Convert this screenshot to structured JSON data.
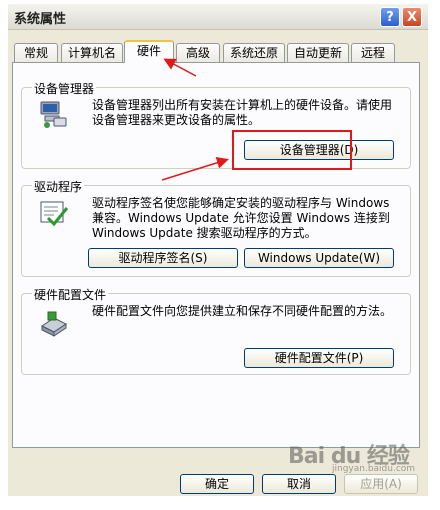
{
  "window": {
    "title": "系统属性",
    "help_label": "?",
    "close_label": "X"
  },
  "tabs": [
    {
      "label": "常规"
    },
    {
      "label": "计算机名"
    },
    {
      "label": "硬件",
      "active": true
    },
    {
      "label": "高级"
    },
    {
      "label": "系统还原"
    },
    {
      "label": "自动更新"
    },
    {
      "label": "远程"
    }
  ],
  "groups": {
    "device_manager": {
      "title": "设备管理器",
      "icon": "device-manager-icon",
      "description": "设备管理器列出所有安装在计算机上的硬件设备。请使用设备管理器来更改设备的属性。",
      "button_label": "设备管理器(D)"
    },
    "drivers": {
      "title": "驱动程序",
      "icon": "driver-signing-icon",
      "description": "驱动程序签名使您能够确定安装的驱动程序与 Windows 兼容。Windows Update 允许您设置 Windows 连接到 Windows Update 搜索驱动程序的方式。",
      "signing_button_label": "驱动程序签名(S)",
      "update_button_label": "Windows Update(W)"
    },
    "hardware_profiles": {
      "title": "硬件配置文件",
      "icon": "hardware-profile-icon",
      "description": "硬件配置文件向您提供建立和保存不同硬件配置的方法。",
      "button_label": "硬件配置文件(P)"
    }
  },
  "dialog_buttons": {
    "ok": "确定",
    "cancel": "取消",
    "apply": "应用(A)"
  },
  "watermark": {
    "main": "Bai du 经验",
    "sub": "jingyan.baidu.com"
  },
  "colors": {
    "highlight": "#e01a1a",
    "dialog_bg": "#ece9d8",
    "panel_bg": "#fcfcfe"
  }
}
